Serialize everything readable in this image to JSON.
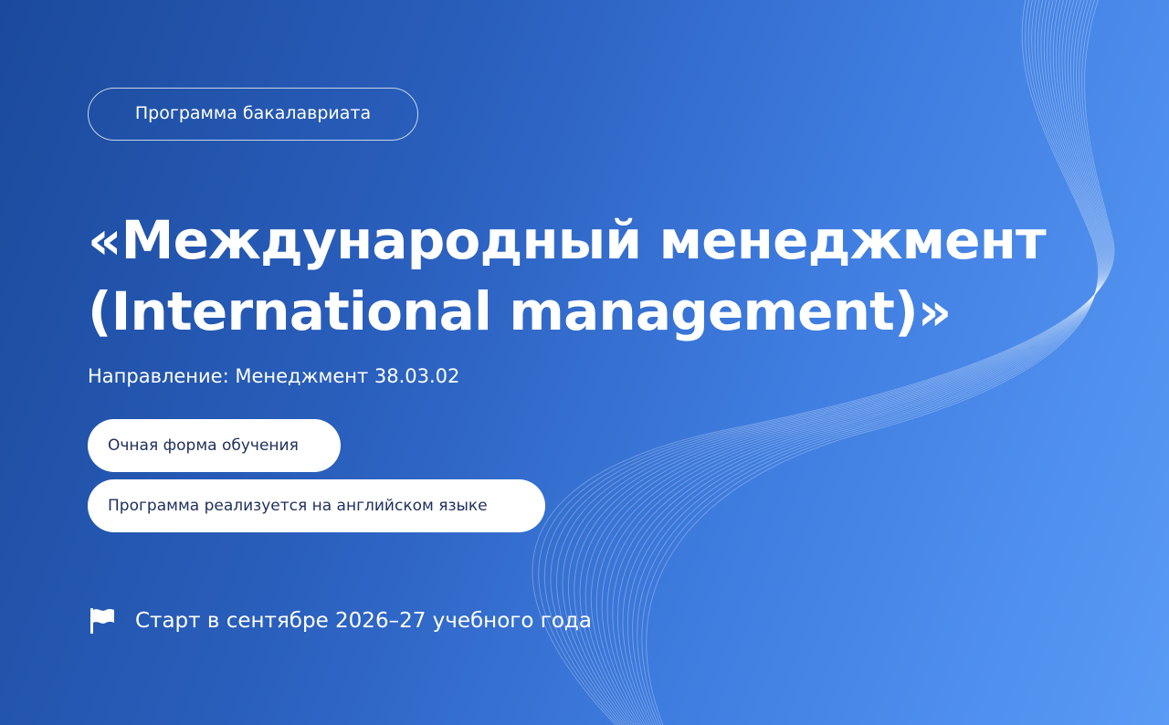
{
  "hero": {
    "badge_label": "Программа бакалавриата",
    "title_line1": "«Международный менеджмент",
    "title_line2": "(International management)»",
    "direction": "Направление: Менеджмент 38.03.02",
    "tags": [
      "Очная форма обучения",
      "Программа реализуется на английском языке"
    ],
    "start_icon": "flag-icon",
    "start_text": "Старт в сентябре 2026–27 учебного года"
  },
  "colors": {
    "gradient_start": "#1b4a9c",
    "gradient_end": "#5a9bf6",
    "pill_background": "#ffffff",
    "pill_text": "#1f2f5c",
    "text": "#ffffff"
  }
}
